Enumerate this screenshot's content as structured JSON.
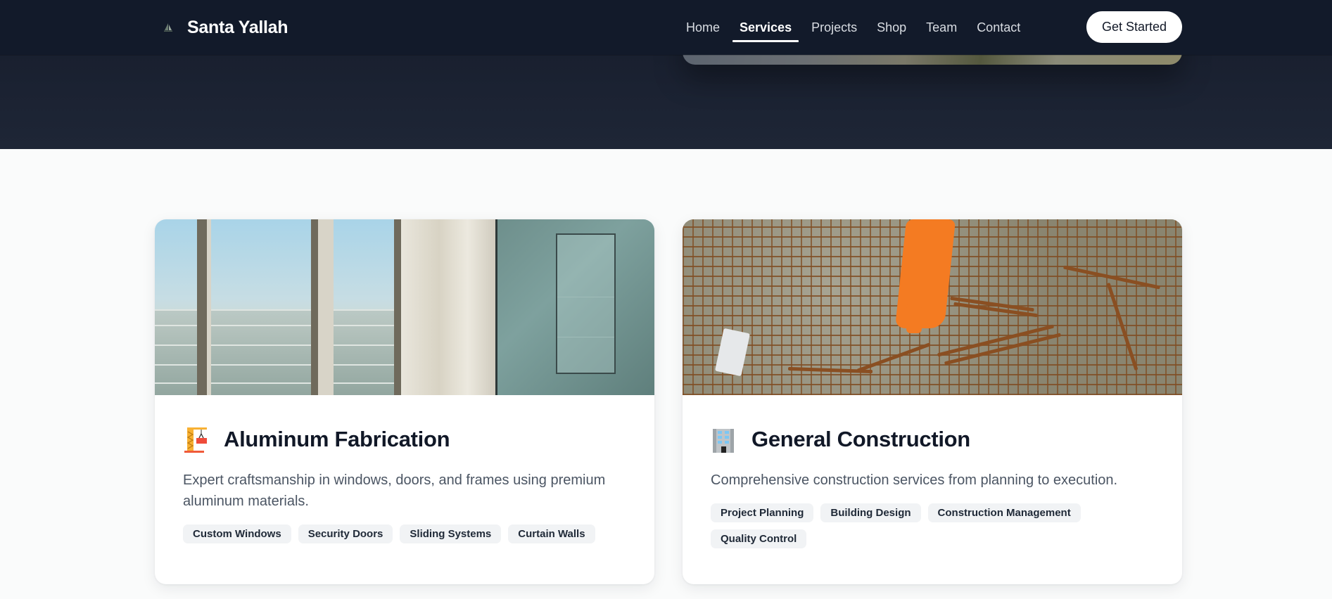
{
  "nav": {
    "brand": "Santa Yallah",
    "brand_icon": "sailboat-icon",
    "links": [
      {
        "label": "Home",
        "active": false
      },
      {
        "label": "Services",
        "active": true
      },
      {
        "label": "Projects",
        "active": false
      },
      {
        "label": "Shop",
        "active": false
      },
      {
        "label": "Team",
        "active": false
      },
      {
        "label": "Contact",
        "active": false
      }
    ],
    "cta_label": "Get Started"
  },
  "services": [
    {
      "icon": "crane-icon",
      "title": "Aluminum Fabrication",
      "description": "Expert craftsmanship in windows, doors, and frames using premium aluminum materials.",
      "tags": [
        "Custom Windows",
        "Security Doors",
        "Sliding Systems",
        "Curtain Walls"
      ],
      "image": "Interior with aluminum-framed windows and glass display cabinet"
    },
    {
      "icon": "office-building-icon",
      "title": "General Construction",
      "description": "Comprehensive construction services from planning to execution.",
      "tags": [
        "Project Planning",
        "Building Design",
        "Construction Management",
        "Quality Control"
      ],
      "image": "Worker in orange coveralls walking on rebar mesh"
    }
  ],
  "colors": {
    "nav_bg": "#121a2a",
    "hero_bg": "#1b2232",
    "page_bg": "#fafbfb",
    "title_text": "#111827",
    "body_text": "#4b5563",
    "tag_bg": "#f1f3f5"
  }
}
